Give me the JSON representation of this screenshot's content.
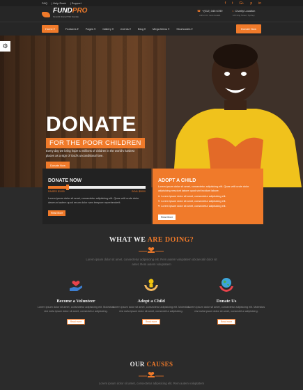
{
  "topbar": {
    "links": [
      "FAQ",
      "Help Desk",
      "Support"
    ],
    "social_icons": [
      "facebook-icon",
      "twitter-icon",
      "google-plus-icon",
      "pinterest-icon",
      "linkedin-icon"
    ],
    "social_glyphs": [
      "f",
      "t",
      "G+",
      "p",
      "in"
    ]
  },
  "header": {
    "logo_part1": "FUND",
    "logo_part2": "PRO",
    "logo_sub": "Nonprofit Charity HTML Template",
    "phone": "+(012) 345 6789",
    "phone_sub": "call us for more details",
    "location": "Charity Location",
    "location_sub": "123 king Street, Sydney"
  },
  "nav": {
    "items": [
      "Home",
      "Features",
      "Pages",
      "Gallery",
      "events",
      "Blog",
      "Mega Menu",
      "Shortcodes"
    ],
    "donate": "Donate Now"
  },
  "hero": {
    "title": "DONATE",
    "tagline": "FOR THE POOR CHILDREN",
    "description": "Every day we bring hope to millions of children in the world's hardest places as a sign of God's unconditional love.",
    "button": "Donate Now",
    "settings_icon": "gear-icon"
  },
  "donate_box": {
    "title": "DONATE NOW",
    "raised": "RAISED $1000",
    "goal": "GOAL $5000",
    "progress": 0.2,
    "text": "Lorem ipsum dolor sit amet, consectetur adipisicing elit. Quas velit unde dolor deserunt autem quod rerum dolor nam tempore reprehenderit.",
    "button": "Read More"
  },
  "adopt_box": {
    "title": "ADOPT A CHILD",
    "text": "Lorem ipsum dolor sit amet, consectetur adipisicing elit. Quas velit unde dolor adipisicing nesciunt labore quod sint incidunt labore.",
    "list": [
      "Lorem ipsum dolor sit amet, consectetur adipisicing elit.",
      "Lorem ipsum dolor sit amet, consectetur adipisicing elit.",
      "Lorem ipsum dolor sit amet, consectetur adipisicing elit."
    ],
    "button": "Read More"
  },
  "doing": {
    "title_part1": "WHAT WE ",
    "title_part2": "ARE DOING?",
    "intro": "Lorem ipsum dolor sit amet, consectetur adipisicing elit. Rem autem voluptatem obcaecati! dolor sit amet. Rem autem voluptatem",
    "columns": [
      {
        "title": "Become a Volunteer",
        "text": "Lorem ipsum dolor sit amet, consectetur adipisicing elit. Molestias nisi nulla ipsum dolor sit amet, consectetur adipisicing.",
        "button": "Read more",
        "icon": "volunteer-hand-heart-icon"
      },
      {
        "title": "Adopt a Child",
        "text": "Lorem ipsum dolor sit amet, consectetur adipisicing elit. Molestias nisi nulla ipsum dolor sit amet, consectetur adipisicing.",
        "button": "Read more",
        "icon": "hands-child-icon"
      },
      {
        "title": "Donate Us",
        "text": "Lorem ipsum dolor sit amet, consectetur adipisicing elit. Molestias nisi nulla ipsum dolor sit amet, consectetur adipisicing.",
        "button": "Read more",
        "icon": "globe-hands-icon"
      }
    ]
  },
  "causes": {
    "title_part1": "OUR ",
    "title_part2": "CAUSES",
    "intro": "Lorem ipsum dolor sit amet, consectetur adipisicing elit. Rem autem voluptatem"
  },
  "colors": {
    "accent": "#f07a2a",
    "dark": "#2b2b2b"
  }
}
